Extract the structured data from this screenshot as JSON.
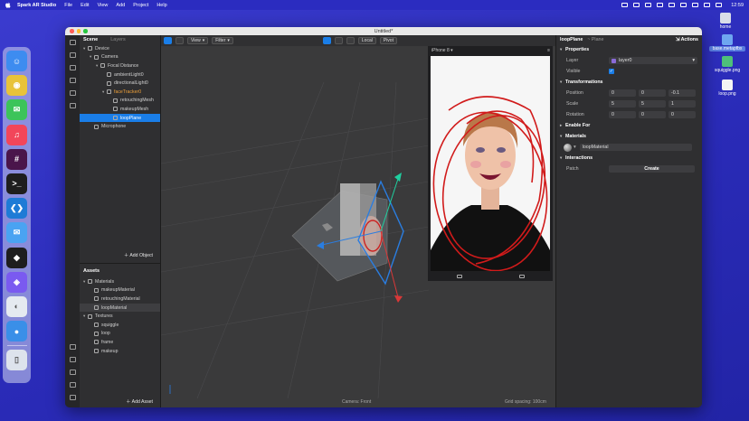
{
  "menubar": {
    "app": "Spark AR Studio",
    "items": [
      "File",
      "Edit",
      "View",
      "Add",
      "Project",
      "Help"
    ],
    "clock": "12:59"
  },
  "desktop": {
    "icons": [
      {
        "label": "home",
        "color": "#d9dde8"
      },
      {
        "label": "base.metapfbx",
        "color": "#6ea6f0"
      },
      {
        "label": "squiggle.png",
        "color": "#4ec07a"
      },
      {
        "label": "loop.png",
        "color": "#f4f4f4"
      }
    ]
  },
  "dock": {
    "apps": [
      {
        "name": "finder-icon",
        "color": "#3d8cf0",
        "glyph": "☺"
      },
      {
        "name": "chrome-icon",
        "color": "#e8c33a",
        "glyph": "◉"
      },
      {
        "name": "messages-icon",
        "color": "#3cc45a",
        "glyph": "✉"
      },
      {
        "name": "music-icon",
        "color": "#f2465a",
        "glyph": "♫"
      },
      {
        "name": "slack-icon",
        "color": "#4a154b",
        "glyph": "#"
      },
      {
        "name": "terminal-icon",
        "color": "#1e1e1e",
        "glyph": ">_"
      },
      {
        "name": "vscode-icon",
        "color": "#1e7bd6",
        "glyph": "❮❯"
      },
      {
        "name": "mail-icon",
        "color": "#4aa3f2",
        "glyph": "✉"
      },
      {
        "name": "figma-icon",
        "color": "#1e1e1e",
        "glyph": "◆"
      },
      {
        "name": "spark-ar-icon",
        "color": "#7a5af0",
        "glyph": "◈"
      },
      {
        "name": "blender-icon",
        "color": "#e5eaf0",
        "glyph": "◐"
      },
      {
        "name": "tweetbot-icon",
        "color": "#3a8fe8",
        "glyph": "●"
      },
      {
        "name": "trash-icon",
        "color": "#dde3ec",
        "glyph": "▯"
      }
    ]
  },
  "window": {
    "title": "Untitled*",
    "scene_tabs": {
      "active": "Scene",
      "inactive": "Layers"
    },
    "scene_tree": [
      {
        "label": "Device",
        "indent": 0,
        "caret": "▾",
        "style": ""
      },
      {
        "label": "Camera",
        "indent": 1,
        "caret": "▾",
        "style": ""
      },
      {
        "label": "Focal Distance",
        "indent": 2,
        "caret": "▾",
        "style": ""
      },
      {
        "label": "ambientLight0",
        "indent": 3,
        "caret": "",
        "style": ""
      },
      {
        "label": "directionalLight0",
        "indent": 3,
        "caret": "",
        "style": ""
      },
      {
        "label": "faceTracker0",
        "indent": 3,
        "caret": "▾",
        "style": "orange"
      },
      {
        "label": "retouchingMesh",
        "indent": 4,
        "caret": "",
        "style": ""
      },
      {
        "label": "makeupMesh",
        "indent": 4,
        "caret": "",
        "style": ""
      },
      {
        "label": "loopPlane",
        "indent": 4,
        "caret": "",
        "style": "sel"
      },
      {
        "label": "Microphone",
        "indent": 1,
        "caret": "",
        "style": ""
      }
    ],
    "add_object": "Add Object",
    "assets_header": "Assets",
    "assets_tree": [
      {
        "label": "Materials",
        "indent": 0,
        "caret": "▾",
        "style": ""
      },
      {
        "label": "makeupMaterial",
        "indent": 1,
        "caret": "",
        "style": ""
      },
      {
        "label": "retouchingMaterial",
        "indent": 1,
        "caret": "",
        "style": ""
      },
      {
        "label": "loopMaterial",
        "indent": 1,
        "caret": "",
        "style": "hover"
      },
      {
        "label": "Textures",
        "indent": 0,
        "caret": "▾",
        "style": ""
      },
      {
        "label": "squiggle",
        "indent": 1,
        "caret": "",
        "style": ""
      },
      {
        "label": "loop",
        "indent": 1,
        "caret": "",
        "style": ""
      },
      {
        "label": "frame",
        "indent": 1,
        "caret": "",
        "style": ""
      },
      {
        "label": "makeup",
        "indent": 1,
        "caret": "",
        "style": ""
      }
    ],
    "add_asset": "Add Asset",
    "viewport": {
      "view_label": "View",
      "filter_label": "Filter",
      "local_label": "Local",
      "pivot_label": "Pivot",
      "device": "iPhone 8",
      "camera_status": "Camera: Front",
      "grid_status": "Grid spacing: 100cm"
    },
    "inspector": {
      "title": "loopPlane",
      "type": "~ Plane",
      "actions": "Actions",
      "sections": {
        "properties": "Properties",
        "transformations": "Transformations",
        "enable_for": "Enable For",
        "materials": "Materials",
        "interactions": "Interactions"
      },
      "layer_label": "Layer",
      "layer_value": "layer0",
      "visible_label": "Visible",
      "position_label": "Position",
      "position": [
        "0",
        "0",
        "-0.1"
      ],
      "scale_label": "Scale",
      "scale": [
        "5",
        "5",
        "1"
      ],
      "rotation_label": "Rotation",
      "rotation": [
        "0",
        "0",
        "0"
      ],
      "material_value": "loopMaterial",
      "patch_label": "Patch",
      "create_label": "Create"
    }
  }
}
